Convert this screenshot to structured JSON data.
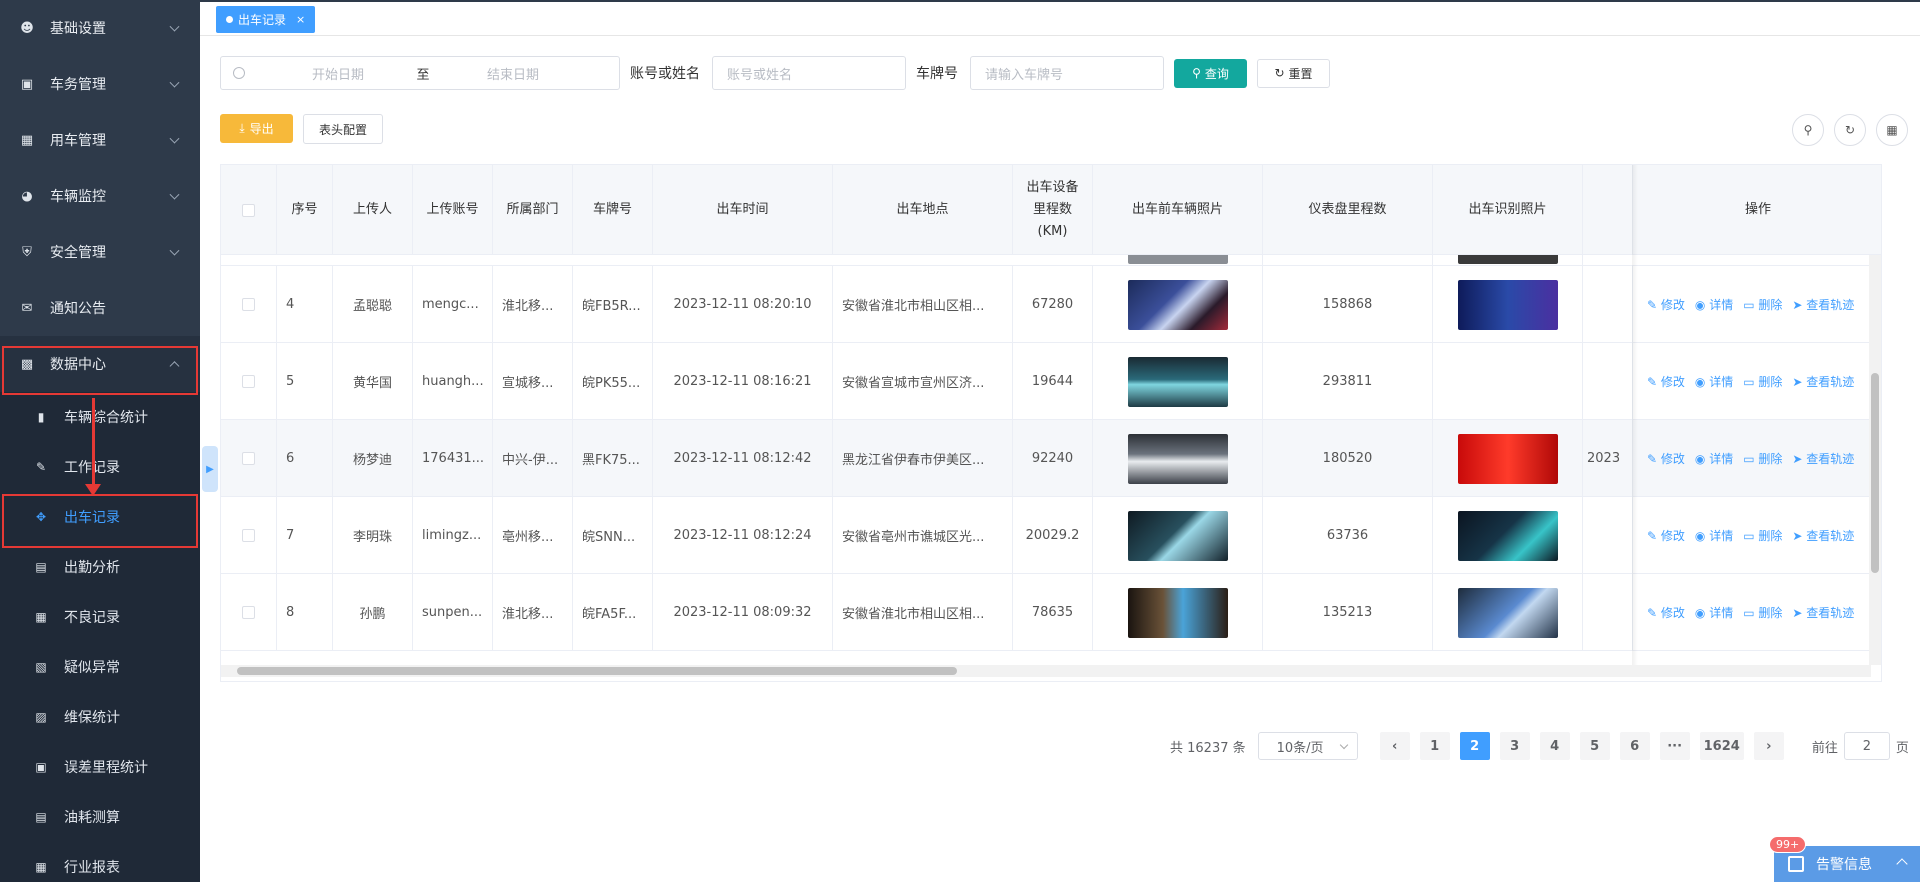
{
  "sidebar": {
    "items": [
      {
        "label": "基础设置",
        "icon": "user-icon"
      },
      {
        "label": "车务管理",
        "icon": "monitor-icon"
      },
      {
        "label": "用车管理",
        "icon": "doc-icon"
      },
      {
        "label": "车辆监控",
        "icon": "globe-icon"
      },
      {
        "label": "安全管理",
        "icon": "shield-icon"
      },
      {
        "label": "通知公告",
        "icon": "chat-icon"
      },
      {
        "label": "数据中心",
        "icon": "lock-icon"
      }
    ],
    "sub_items": [
      {
        "label": "车辆综合统计",
        "icon": "bar-chart-icon"
      },
      {
        "label": "工作记录",
        "icon": "edit-icon"
      },
      {
        "label": "出车记录",
        "icon": "move-icon"
      },
      {
        "label": "出勤分析",
        "icon": "calendar-icon"
      },
      {
        "label": "不良记录",
        "icon": "grid-icon"
      },
      {
        "label": "疑似异常",
        "icon": "note-icon"
      },
      {
        "label": "维保统计",
        "icon": "file-icon"
      },
      {
        "label": "误差里程统计",
        "icon": "image-icon"
      },
      {
        "label": "油耗测算",
        "icon": "list-icon"
      },
      {
        "label": "行业报表",
        "icon": "report-icon"
      }
    ]
  },
  "tabs": {
    "active": "出车记录",
    "close": "×"
  },
  "filter": {
    "start_placeholder": "开始日期",
    "range_sep": "至",
    "end_placeholder": "结束日期",
    "account_label": "账号或姓名",
    "account_placeholder": "账号或姓名",
    "plate_label": "车牌号",
    "plate_placeholder": "请输入车牌号",
    "query": "查询",
    "reset": "重置"
  },
  "toolbar": {
    "export": "导出",
    "columns": "表头配置"
  },
  "table": {
    "headers": [
      "序号",
      "上传人",
      "上传账号",
      "所属部门",
      "车牌号",
      "出车时间",
      "出车地点",
      "出车设备里程数(KM)",
      "出车前车辆照片",
      "仪表盘里程数",
      "出车识别照片",
      "",
      "操作"
    ],
    "rows": [
      {
        "no": "4",
        "user": "孟聪聪",
        "account": "mengc...",
        "dept": "淮北移...",
        "plate": "皖FB5R...",
        "time": "2023-12-11 08:20:10",
        "place": "安徽省淮北市相山区相...",
        "mileage": "67280",
        "dash": "158868",
        "extra": ""
      },
      {
        "no": "5",
        "user": "黄华国",
        "account": "huangh...",
        "dept": "宣城移...",
        "plate": "皖PK55...",
        "time": "2023-12-11 08:16:21",
        "place": "安徽省宣城市宣州区济...",
        "mileage": "19644",
        "dash": "293811",
        "extra": ""
      },
      {
        "no": "6",
        "user": "杨梦迪",
        "account": "176431...",
        "dept": "中兴-伊...",
        "plate": "黑FK75...",
        "time": "2023-12-11 08:12:42",
        "place": "黑龙江省伊春市伊美区...",
        "mileage": "92240",
        "dash": "180520",
        "extra": "2023"
      },
      {
        "no": "7",
        "user": "李明珠",
        "account": "limingz...",
        "dept": "亳州移...",
        "plate": "皖SNN...",
        "time": "2023-12-11 08:12:24",
        "place": "安徽省亳州市谯城区光...",
        "mileage": "20029.2",
        "dash": "63736",
        "extra": ""
      },
      {
        "no": "8",
        "user": "孙鹏",
        "account": "sunpen...",
        "dept": "淮北移...",
        "plate": "皖FA5F...",
        "time": "2023-12-11 08:09:32",
        "place": "安徽省淮北市相山区相...",
        "mileage": "78635",
        "dash": "135213",
        "extra": ""
      }
    ],
    "ops": {
      "edit": "修改",
      "detail": "详情",
      "delete": "删除",
      "track": "查看轨迹"
    }
  },
  "pagination": {
    "total": "共 16237 条",
    "page_size": "10条/页",
    "pages": [
      "1",
      "2",
      "3",
      "4",
      "5",
      "6",
      "···",
      "1624"
    ],
    "current": "2",
    "goto_label": "前往",
    "goto_value": "2",
    "goto_unit": "页"
  },
  "alarm": {
    "label": "告警信息",
    "badge": "99+"
  },
  "colors": {
    "sidebar": "#2e3a4a",
    "primary": "#409eff",
    "query": "#13a89e",
    "export": "#f7b93a",
    "highlight": "#e53935"
  }
}
